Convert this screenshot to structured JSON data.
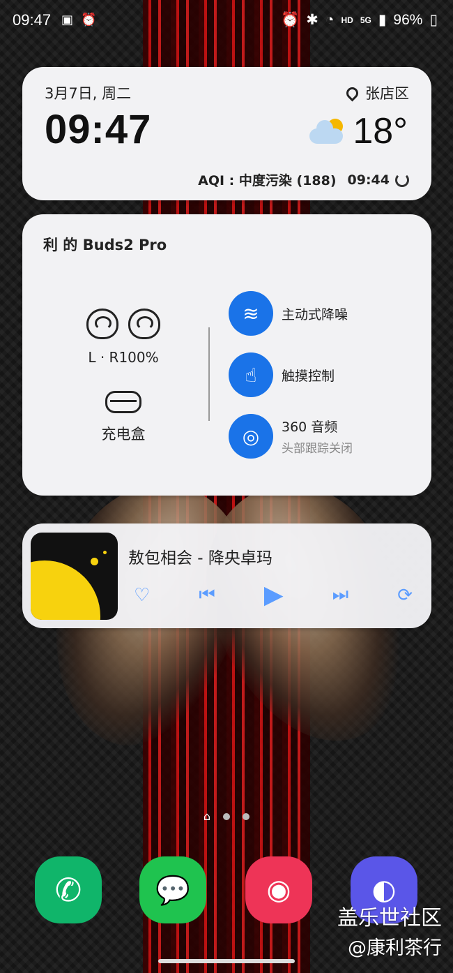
{
  "status_bar": {
    "time": "09:47",
    "network": "HD",
    "signal": "5G",
    "battery": "96%"
  },
  "clock_widget": {
    "date": "3月7日, 周二",
    "time": "09:47",
    "location": "张店区",
    "temperature": "18°",
    "aqi": "AQI : 中度污染 (188)",
    "updated": "09:44"
  },
  "buds_widget": {
    "title": "利 的 Buds2 Pro",
    "battery": "L · R100%",
    "case_label": "充电盒",
    "features": [
      {
        "label": "主动式降噪",
        "sub": ""
      },
      {
        "label": "触摸控制",
        "sub": ""
      },
      {
        "label": "360 音频",
        "sub": "头部跟踪关闭"
      }
    ]
  },
  "music_widget": {
    "song": "敖包相会   - 降央卓玛"
  },
  "watermark": {
    "line1": "盖乐世社区",
    "line2": "@康利茶行"
  },
  "colors": {
    "accent": "#1a73e8",
    "controls": "#5b9cff",
    "card": "#f2f2f4"
  }
}
